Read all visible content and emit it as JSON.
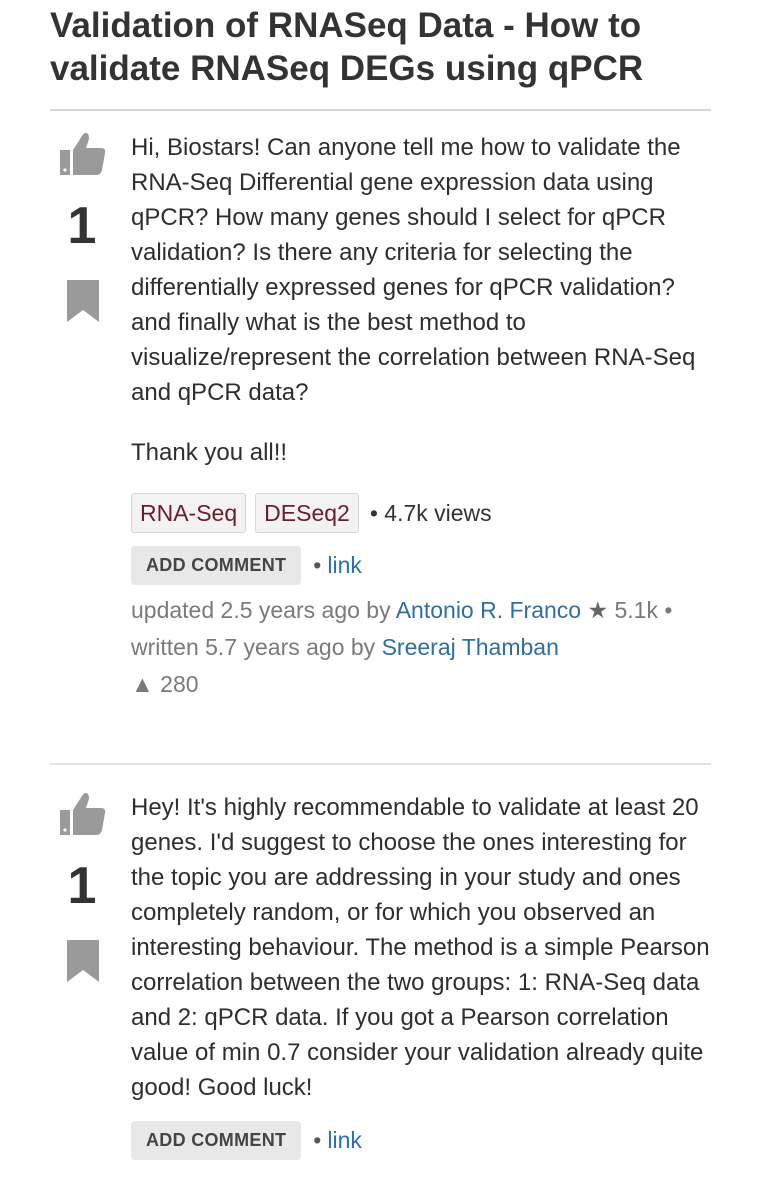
{
  "question": {
    "title": "Validation of RNASeq Data - How to validate RNASeq DEGs using qPCR",
    "votes": "1",
    "body": "Hi, Biostars! Can anyone tell me how to validate the RNA-Seq Differential gene expression data using qPCR? How many genes should I select for qPCR validation? Is there any criteria for selecting the differentially expressed genes for qPCR validation? and finally what is the best method to visualize/represent the correlation between RNA-Seq and qPCR data?",
    "thanks": "Thank you all!!",
    "tags": [
      "RNA-Seq",
      "DESeq2"
    ],
    "views": "4.7k views",
    "add_comment": "ADD COMMENT",
    "link": "link",
    "updated_prefix": "updated 2.5 years ago by",
    "updated_user": "Antonio R. Franco",
    "updated_user_rep": "5.1k",
    "written_prefix": "written 5.7 years ago by",
    "author": "Sreeraj Thamban",
    "author_rep": "280"
  },
  "answer": {
    "votes": "1",
    "body": "Hey! It's highly recommendable to validate at least 20 genes. I'd suggest to choose the ones interesting for the topic you are addressing in your study and ones completely random, or for which you observed an interesting behaviour. The method is a simple Pearson correlation between the two groups: 1: RNA-Seq data and 2: qPCR data. If you got a Pearson correlation value of min 0.7 consider your validation already quite good! Good luck!",
    "add_comment": "ADD COMMENT",
    "link": "link"
  },
  "icons": {
    "thumb": "thumbs-up-icon",
    "bookmark": "bookmark-icon",
    "star": "star-icon",
    "triangle": "triangle-up-icon"
  },
  "colors": {
    "link": "#2a6fb0",
    "tag_text": "#6b1d2e",
    "icon_gray": "#9a9a9a"
  }
}
